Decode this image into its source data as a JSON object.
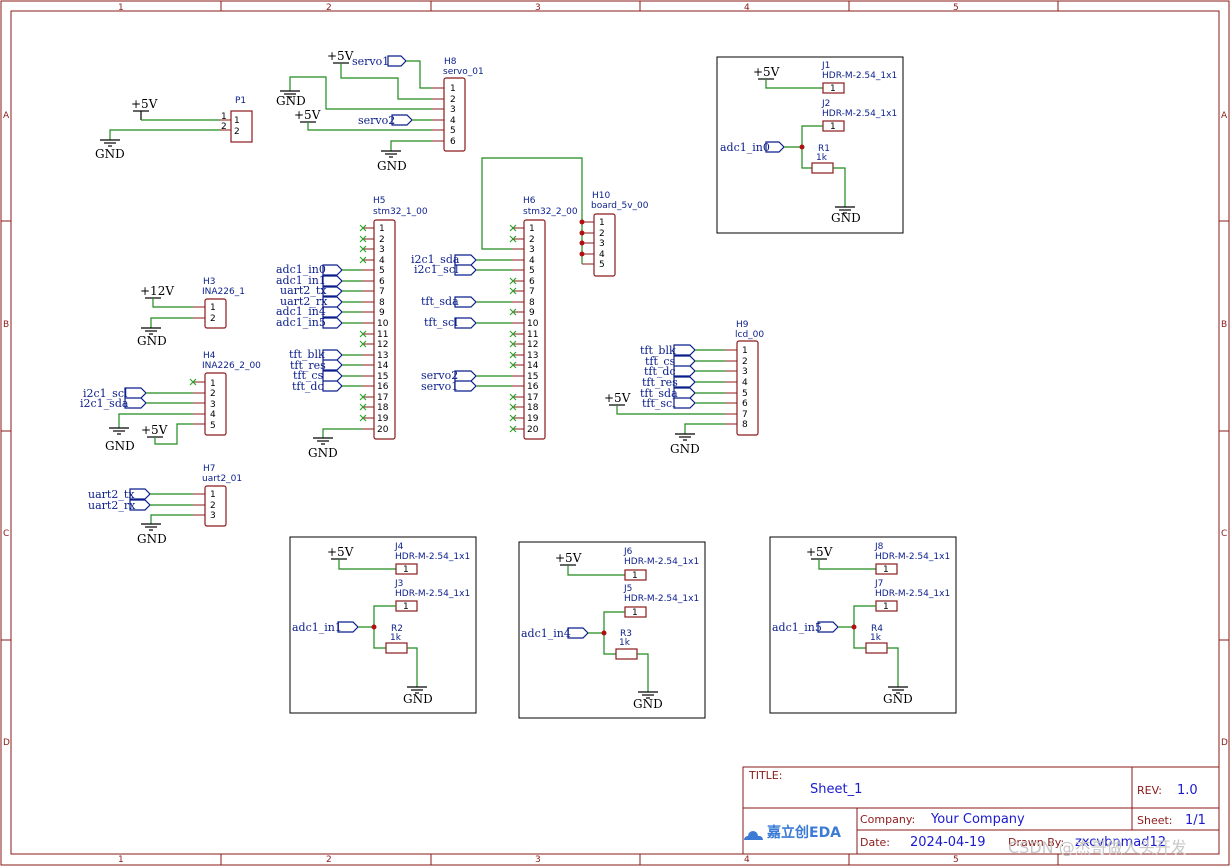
{
  "frame": {
    "columns": [
      "1",
      "2",
      "3",
      "4",
      "5"
    ],
    "rows": [
      "A",
      "B",
      "C",
      "D"
    ]
  },
  "power": {
    "p5v": "+5V",
    "p12v": "+12V",
    "gnd": "GND"
  },
  "parts": {
    "P1": {
      "ref": "P1",
      "pins": [
        "1",
        "2"
      ]
    },
    "H8": {
      "ref": "H8",
      "value": "servo_01",
      "pins": [
        "1",
        "2",
        "3",
        "4",
        "5",
        "6"
      ]
    },
    "H5": {
      "ref": "H5",
      "value": "stm32_1_00"
    },
    "H6": {
      "ref": "H6",
      "value": "stm32_2_00"
    },
    "H10": {
      "ref": "H10",
      "value": "board_5v_00",
      "pins": [
        "1",
        "2",
        "3",
        "4",
        "5"
      ]
    },
    "H3": {
      "ref": "H3",
      "value": "INA226_1",
      "pins": [
        "1",
        "2"
      ]
    },
    "H4": {
      "ref": "H4",
      "value": "INA226_2_00",
      "pins": [
        "1",
        "2",
        "3",
        "4",
        "5"
      ]
    },
    "H7": {
      "ref": "H7",
      "value": "uart2_01",
      "pins": [
        "1",
        "2",
        "3"
      ]
    },
    "H9": {
      "ref": "H9",
      "value": "lcd_00",
      "pins": [
        "1",
        "2",
        "3",
        "4",
        "5",
        "6",
        "7",
        "8"
      ]
    },
    "header_value": "HDR-M-2.54_1x1",
    "resistor_value": "1k",
    "J1": "J1",
    "J2": "J2",
    "J3": "J3",
    "J4": "J4",
    "J5": "J5",
    "J6": "J6",
    "J7": "J7",
    "J8": "J8",
    "R1": "R1",
    "R2": "R2",
    "R3": "R3",
    "R4": "R4",
    "pin1": "1"
  },
  "pins20": [
    "1",
    "2",
    "3",
    "4",
    "5",
    "6",
    "7",
    "8",
    "9",
    "10",
    "11",
    "12",
    "13",
    "14",
    "15",
    "16",
    "17",
    "18",
    "19",
    "20"
  ],
  "nets": {
    "servo1": "servo1",
    "servo2": "servo2",
    "adc1_in0": "adc1_in0",
    "adc1_in1": "adc1_in1",
    "adc1_in4": "adc1_in4",
    "adc1_in5": "adc1_in5",
    "uart2_tx": "uart2_tx",
    "uart2_rx": "uart2_rx",
    "tft_blk": "tft_blk",
    "tft_res": "tft_res",
    "tft_cs": "tft_cs",
    "tft_dc": "tft_dc",
    "tft_sda": "tft_sda",
    "tft_scl": "tft_scl",
    "i2c1_sda": "i2c1_sda",
    "i2c1_scl": "i2c1_scl"
  },
  "title_block": {
    "title_label": "TITLE:",
    "title": "Sheet_1",
    "rev_label": "REV:",
    "rev": "1.0",
    "company_label": "Company:",
    "company": "Your Company",
    "sheet_label": "Sheet:",
    "sheet": "1/1",
    "date_label": "Date:",
    "date": "2024-04-19",
    "drawn_label": "Drawn By:",
    "drawn": "zxcvbnmad12",
    "logo": "嘉立创EDA"
  },
  "watermark": "CSDN @杰哥做人头开发"
}
